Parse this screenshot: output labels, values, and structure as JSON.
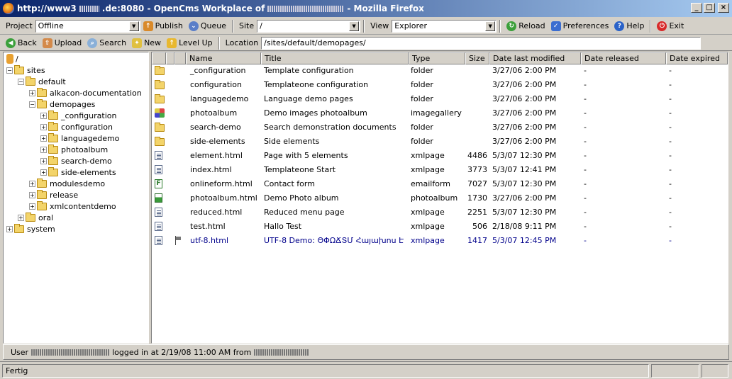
{
  "window": {
    "title_prefix": "http://www3",
    "title_host": ".de:8080 - OpenCms Workplace of",
    "title_suffix": "- Mozilla Firefox",
    "minimize": "_",
    "maximize": "□",
    "close": "×"
  },
  "toolbar1": {
    "project_label": "Project",
    "project_value": "Offline",
    "publish_label": "Publish",
    "queue_label": "Queue",
    "site_label": "Site",
    "site_value": "/",
    "view_label": "View",
    "view_value": "Explorer",
    "reload_label": "Reload",
    "preferences_label": "Preferences",
    "help_label": "Help",
    "exit_label": "Exit"
  },
  "toolbar2": {
    "back_label": "Back",
    "upload_label": "Upload",
    "search_label": "Search",
    "new_label": "New",
    "levelup_label": "Level Up",
    "location_label": "Location",
    "location_value": "/sites/default/demopages/"
  },
  "tree": [
    {
      "label": "/",
      "icon": "root-icon"
    },
    {
      "label": "sites",
      "icon": "folder-icon"
    },
    {
      "label": "default",
      "icon": "folder-open-icon"
    },
    {
      "label": "alkacon-documentation",
      "icon": "folder-icon"
    },
    {
      "label": "demopages",
      "icon": "folder-open-icon"
    },
    {
      "label": "_configuration",
      "icon": "folder-icon"
    },
    {
      "label": "configuration",
      "icon": "folder-icon"
    },
    {
      "label": "languagedemo",
      "icon": "folder-icon"
    },
    {
      "label": "photoalbum",
      "icon": "folder-icon"
    },
    {
      "label": "search-demo",
      "icon": "folder-icon"
    },
    {
      "label": "side-elements",
      "icon": "folder-icon"
    },
    {
      "label": "modulesdemo",
      "icon": "folder-icon"
    },
    {
      "label": "release",
      "icon": "folder-icon"
    },
    {
      "label": "xmlcontentdemo",
      "icon": "folder-icon"
    },
    {
      "label": "oral",
      "icon": "folder-icon"
    },
    {
      "label": "system",
      "icon": "folder-icon"
    }
  ],
  "columns": [
    "Name",
    "Title",
    "Type",
    "Size",
    "Date last modified",
    "Date released",
    "Date expired"
  ],
  "files": [
    {
      "name": "_configuration",
      "title": "Template configuration",
      "type": "folder",
      "size": "",
      "modified": "3/27/06 2:00 PM",
      "released": "-",
      "expired": "-",
      "icon": "folder-icon"
    },
    {
      "name": "configuration",
      "title": "Templateone configuration",
      "type": "folder",
      "size": "",
      "modified": "3/27/06 2:00 PM",
      "released": "-",
      "expired": "-",
      "icon": "folder-icon"
    },
    {
      "name": "languagedemo",
      "title": "Language demo pages",
      "type": "folder",
      "size": "",
      "modified": "3/27/06 2:00 PM",
      "released": "-",
      "expired": "-",
      "icon": "folder-icon"
    },
    {
      "name": "photoalbum",
      "title": "Demo images photoalbum",
      "type": "imagegallery",
      "size": "",
      "modified": "3/27/06 2:00 PM",
      "released": "-",
      "expired": "-",
      "icon": "image-gallery-icon"
    },
    {
      "name": "search-demo",
      "title": "Search demonstration documents",
      "type": "folder",
      "size": "",
      "modified": "3/27/06 2:00 PM",
      "released": "-",
      "expired": "-",
      "icon": "folder-icon"
    },
    {
      "name": "side-elements",
      "title": "Side elements",
      "type": "folder",
      "size": "",
      "modified": "3/27/06 2:00 PM",
      "released": "-",
      "expired": "-",
      "icon": "folder-icon"
    },
    {
      "name": "element.html",
      "title": "Page with 5 elements",
      "type": "xmlpage",
      "size": "4486",
      "modified": "5/3/07 12:30 PM",
      "released": "-",
      "expired": "-",
      "icon": "page-icon"
    },
    {
      "name": "index.html",
      "title": "Templateone Start",
      "type": "xmlpage",
      "size": "3773",
      "modified": "5/3/07 12:41 PM",
      "released": "-",
      "expired": "-",
      "icon": "page-icon"
    },
    {
      "name": "onlineform.html",
      "title": "Contact form",
      "type": "emailform",
      "size": "7027",
      "modified": "5/3/07 12:30 PM",
      "released": "-",
      "expired": "-",
      "icon": "form-icon"
    },
    {
      "name": "photoalbum.html",
      "title": "Demo Photo album",
      "type": "photoalbum",
      "size": "1730",
      "modified": "3/27/06 2:00 PM",
      "released": "-",
      "expired": "-",
      "icon": "photoalbum-icon"
    },
    {
      "name": "reduced.html",
      "title": "Reduced menu page",
      "type": "xmlpage",
      "size": "2251",
      "modified": "5/3/07 12:30 PM",
      "released": "-",
      "expired": "-",
      "icon": "page-icon"
    },
    {
      "name": "test.html",
      "title": "Hallo Test",
      "type": "xmlpage",
      "size": "506",
      "modified": "2/18/08 9:11 PM",
      "released": "-",
      "expired": "-",
      "icon": "page-icon"
    },
    {
      "name": "utf-8.html",
      "title": "UTF-8 Demo: ΘΦΩՃՏՄ Հայախոս Է",
      "type": "xmlpage",
      "size": "1417",
      "modified": "5/3/07 12:45 PM",
      "released": "-",
      "expired": "-",
      "icon": "page-icon",
      "changed": true
    }
  ],
  "user_status": {
    "prefix": "User",
    "middle": "logged in at 2/19/08 11:00 AM from"
  },
  "statusbar": {
    "text": "Fertig"
  },
  "colors": {
    "titlebar_start": "#0a246a",
    "titlebar_end": "#a6caf0",
    "chrome": "#d4d0c8",
    "changed_text": "#00008b"
  }
}
